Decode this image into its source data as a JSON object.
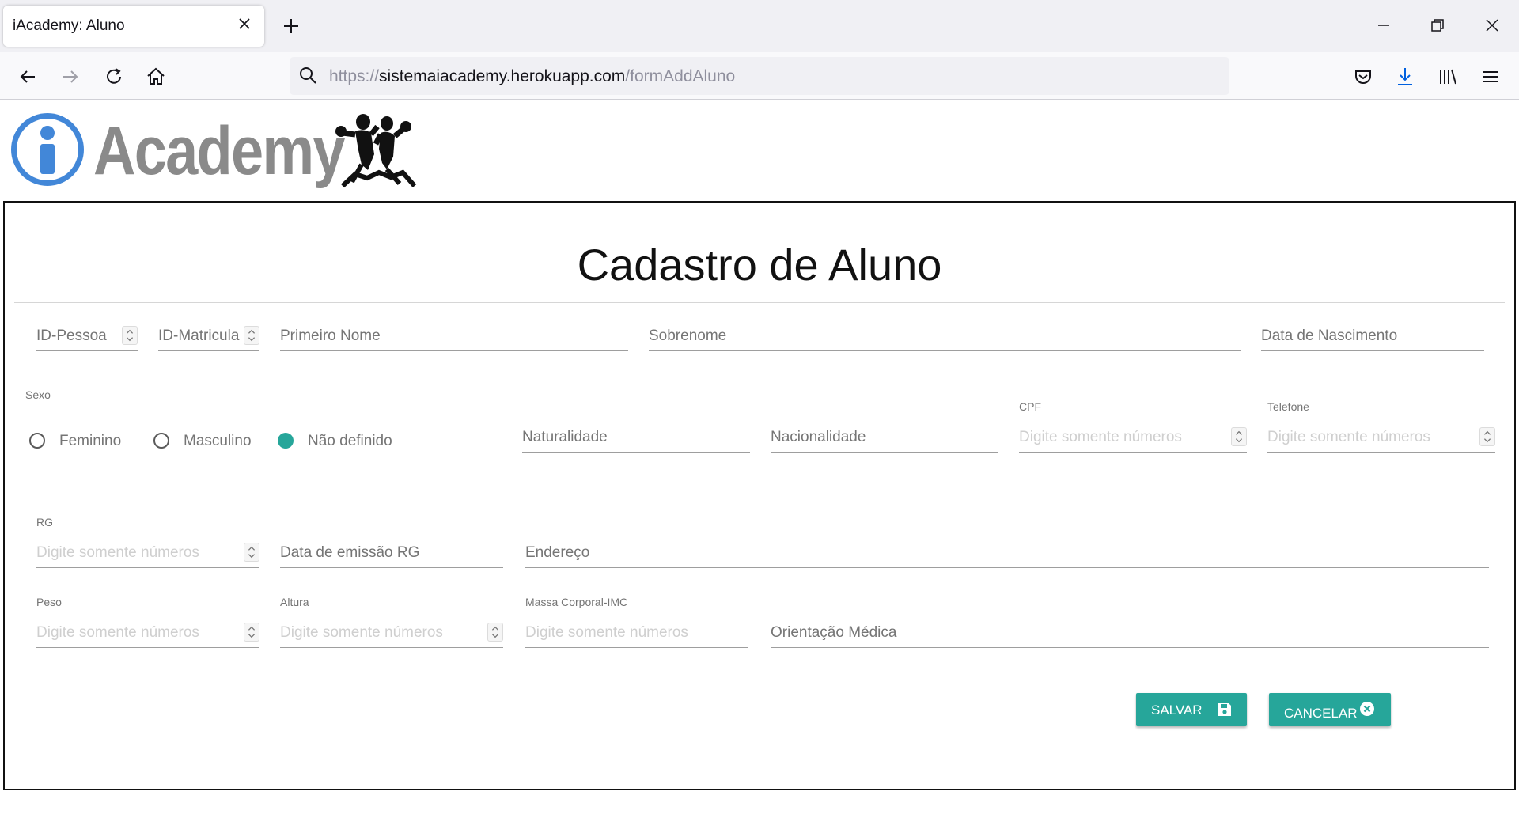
{
  "browser": {
    "tab_title": "iAcademy: Aluno",
    "url_scheme": "https://",
    "url_host": "sistemaiacademy.herokuapp.com",
    "url_path": "/formAddAluno"
  },
  "logo": {
    "text": "Academy"
  },
  "form": {
    "title": "Cadastro de Aluno",
    "id_pessoa": "ID-Pessoa",
    "id_matricula": "ID-Matricula",
    "primeiro_nome": "Primeiro Nome",
    "sobrenome": "Sobrenome",
    "data_nascimento": "Data de Nascimento",
    "sexo_label": "Sexo",
    "sexo_options": [
      "Feminino",
      "Masculino",
      "Não definido"
    ],
    "sexo_selected": "Não definido",
    "naturalidade": "Naturalidade",
    "nacionalidade": "Nacionalidade",
    "cpf_label": "CPF",
    "telefone_label": "Telefone",
    "rg_label": "RG",
    "numeric_placeholder": "Digite somente números",
    "data_emissao_rg": "Data de emissão RG",
    "endereco": "Endereço",
    "peso_label": "Peso",
    "altura_label": "Altura",
    "imc_label": "Massa Corporal-IMC",
    "orientacao_medica": "Orientação Médica",
    "save_label": "SALVAR",
    "cancel_label": "CANCELAR"
  },
  "colors": {
    "accent": "#26a69a",
    "logo_blue": "#4287d8",
    "logo_gray": "#8a8a8a"
  }
}
